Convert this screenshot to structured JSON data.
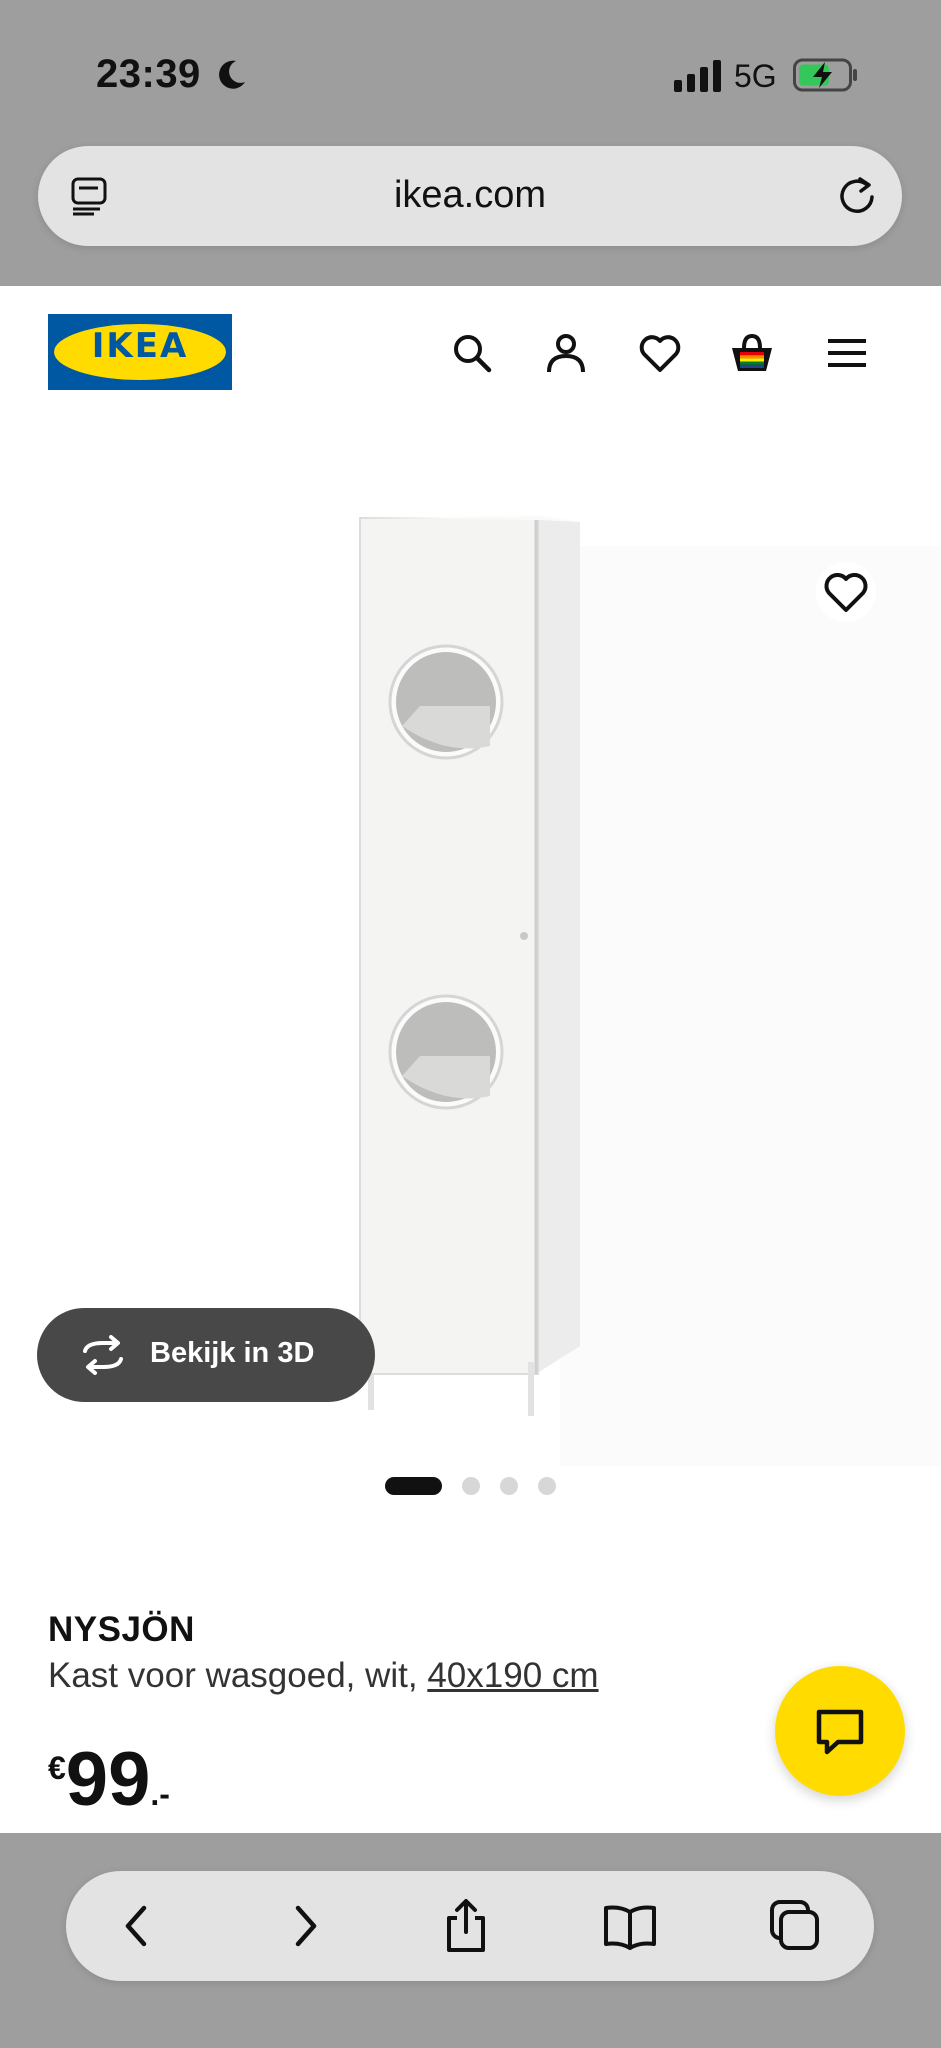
{
  "status_bar": {
    "time": "23:39",
    "network": "5G"
  },
  "browser": {
    "url": "ikea.com"
  },
  "header": {
    "logo_text": "IKEA"
  },
  "gallery": {
    "view_3d_label": "Bekijk in 3D",
    "image_count": 4,
    "active_index": 0
  },
  "product": {
    "name": "NYSJÖN",
    "description": "Kast voor wasgoed, wit, ",
    "size_link": "40x190 cm",
    "price_currency": "€",
    "price_integer": "99",
    "price_decimal": ".-"
  },
  "colors": {
    "ikea_blue": "#0058a3",
    "ikea_yellow": "#ffdb00",
    "chrome_grey": "#9e9e9e"
  },
  "icons": {
    "header": [
      "search-icon",
      "account-icon",
      "heart-icon",
      "shopping-bag-icon",
      "menu-icon"
    ],
    "toolbar": [
      "back-icon",
      "forward-icon",
      "share-icon",
      "bookmarks-icon",
      "tabs-icon"
    ]
  }
}
